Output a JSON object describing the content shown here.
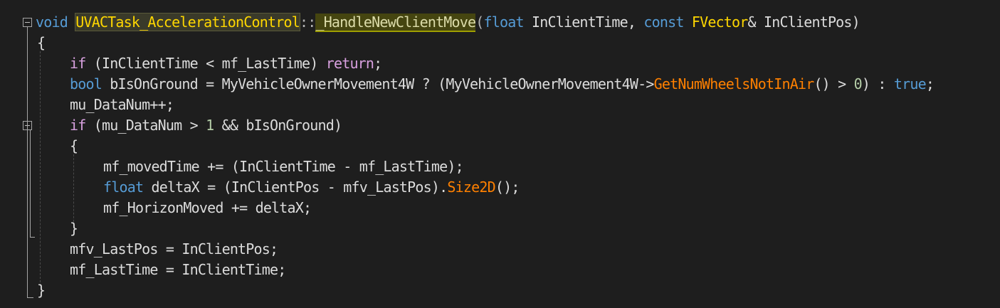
{
  "editor": {
    "language": "C++",
    "theme": "dark",
    "lines": [
      {
        "id": "l1",
        "tokens": [
          {
            "t": "void",
            "c": "kw"
          },
          {
            "t": " ",
            "c": "var"
          },
          {
            "t": "UVACTask_AccelerationControl",
            "c": "cls hl-cls"
          },
          {
            "t": "::",
            "c": "op"
          },
          {
            "t": "_HandleNewClientMove",
            "c": "hl-fn"
          },
          {
            "t": "(",
            "c": "op"
          },
          {
            "t": "float",
            "c": "kw"
          },
          {
            "t": " InClientTime, ",
            "c": "var"
          },
          {
            "t": "const",
            "c": "kw"
          },
          {
            "t": " ",
            "c": "var"
          },
          {
            "t": "FVector",
            "c": "cls"
          },
          {
            "t": "& InClientPos)",
            "c": "var"
          }
        ]
      },
      {
        "id": "l2",
        "tokens": [
          {
            "t": "{",
            "c": "var"
          }
        ]
      },
      {
        "id": "l3",
        "tokens": [
          {
            "t": "if",
            "c": "ctl"
          },
          {
            "t": " (InClientTime < mf_LastTime) ",
            "c": "var"
          },
          {
            "t": "return",
            "c": "ctl"
          },
          {
            "t": ";",
            "c": "var"
          }
        ]
      },
      {
        "id": "l4",
        "tokens": [
          {
            "t": "bool",
            "c": "kw"
          },
          {
            "t": " bIsOnGround = MyVehicleOwnerMovement4W ? (MyVehicleOwnerMovement4W->",
            "c": "var"
          },
          {
            "t": "GetNumWheelsNotInAir",
            "c": "fn2"
          },
          {
            "t": "() > ",
            "c": "var"
          },
          {
            "t": "0",
            "c": "num"
          },
          {
            "t": ") : ",
            "c": "var"
          },
          {
            "t": "true",
            "c": "kw"
          },
          {
            "t": ";",
            "c": "var"
          }
        ]
      },
      {
        "id": "l5",
        "tokens": [
          {
            "t": "mu_DataNum++;",
            "c": "var"
          }
        ]
      },
      {
        "id": "l6",
        "tokens": [
          {
            "t": "if",
            "c": "ctl"
          },
          {
            "t": " (mu_DataNum > ",
            "c": "var"
          },
          {
            "t": "1",
            "c": "num"
          },
          {
            "t": " && bIsOnGround)",
            "c": "var"
          }
        ]
      },
      {
        "id": "l7",
        "tokens": [
          {
            "t": "{",
            "c": "var"
          }
        ]
      },
      {
        "id": "l8",
        "tokens": [
          {
            "t": "mf_movedTime += (InClientTime - mf_LastTime);",
            "c": "var"
          }
        ]
      },
      {
        "id": "l9",
        "tokens": [
          {
            "t": "float",
            "c": "kw"
          },
          {
            "t": " deltaX = (InClientPos - mfv_LastPos).",
            "c": "var"
          },
          {
            "t": "Size2D",
            "c": "fn2"
          },
          {
            "t": "();",
            "c": "var"
          }
        ]
      },
      {
        "id": "l10",
        "tokens": [
          {
            "t": "mf_HorizonMoved += deltaX;",
            "c": "var"
          }
        ]
      },
      {
        "id": "l11",
        "tokens": [
          {
            "t": "}",
            "c": "var"
          }
        ]
      },
      {
        "id": "l12",
        "tokens": [
          {
            "t": "mfv_LastPos = InClientPos;",
            "c": "var"
          }
        ]
      },
      {
        "id": "l13",
        "tokens": [
          {
            "t": "mf_LastTime = InClientTime;",
            "c": "var"
          }
        ]
      },
      {
        "id": "l14",
        "tokens": [
          {
            "t": "}",
            "c": "var"
          }
        ]
      }
    ]
  }
}
